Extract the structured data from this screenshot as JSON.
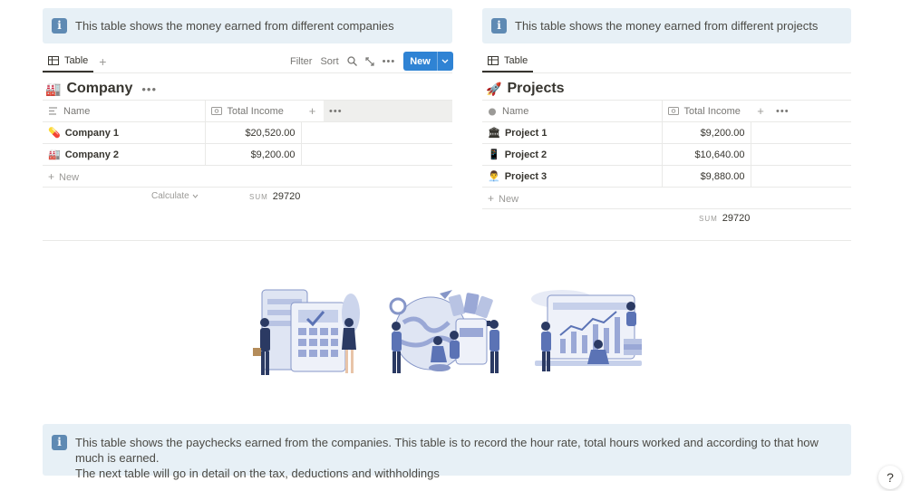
{
  "callouts": {
    "companies": "This table shows the money earned from different companies",
    "projects": "This table shows the money earned from different projects",
    "paychecks_line1": "This table shows the paychecks earned from the companies. This table is to record the hour rate, total hours worked and according to that how much is earned.",
    "paychecks_line2": "The next table will go in detail on the tax, deductions and withholdings"
  },
  "left": {
    "tab_label": "Table",
    "toolbar": {
      "filter": "Filter",
      "sort": "Sort",
      "new": "New"
    },
    "title": "Company",
    "col_name": "Name",
    "col_income": "Total Income",
    "rows": [
      {
        "name": "Company 1",
        "income": "$20,520.00"
      },
      {
        "name": "Company 2",
        "income": "$9,200.00"
      }
    ],
    "new_row": "New",
    "calculate": "Calculate",
    "sum_label": "SUM",
    "sum_value": "29720"
  },
  "right": {
    "tab_label": "Table",
    "title": "Projects",
    "col_name": "Name",
    "col_income": "Total Income",
    "rows": [
      {
        "name": "Project 1",
        "income": "$9,200.00"
      },
      {
        "name": "Project 2",
        "income": "$10,640.00"
      },
      {
        "name": "Project 3",
        "income": "$9,880.00"
      }
    ],
    "new_row": "New",
    "sum_label": "SUM",
    "sum_value": "29720"
  },
  "help": "?",
  "colors": {
    "accent": "#2f83d4",
    "callout_bg": "#e7f0f6",
    "illustration_blue": "#5b73b5"
  }
}
